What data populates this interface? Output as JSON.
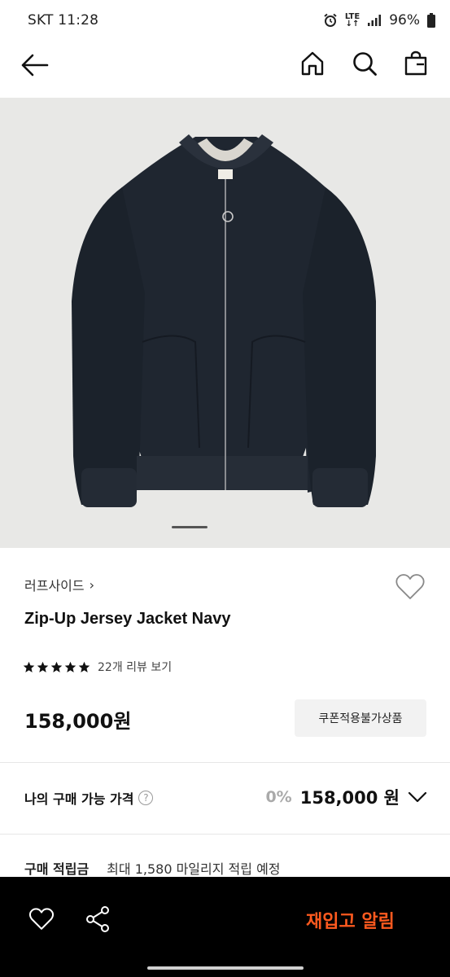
{
  "status_bar": {
    "carrier_time": "SKT 11:28",
    "network": "LTE",
    "battery": "96%"
  },
  "header": {
    "icons": [
      "back-arrow-icon",
      "home-icon",
      "search-icon",
      "shopping-bag-icon"
    ]
  },
  "gallery": {
    "image_desc_icon": "product-photo",
    "current_slide": 1
  },
  "product": {
    "brand": "러프사이드",
    "brand_chevron": "›",
    "name": "Zip-Up Jersey Jacket Navy",
    "rating_stars": 5,
    "review_link": "22개 리뷰 보기",
    "price": "158,000원",
    "coupon_badge": "쿠폰적용불가상품"
  },
  "my_price": {
    "label": "나의 구매 가능 가격",
    "help": "?",
    "discount": "0%",
    "value": "158,000 원"
  },
  "points": {
    "label": "구매 적립금",
    "value": "최대 1,580 마일리지 적립 예정"
  },
  "bottom_bar": {
    "restock_label": "재입고 알림"
  },
  "colors": {
    "accent": "#ff5a1f",
    "bottom_bar_bg": "#000000",
    "hero_bg": "#e8e8e6"
  }
}
